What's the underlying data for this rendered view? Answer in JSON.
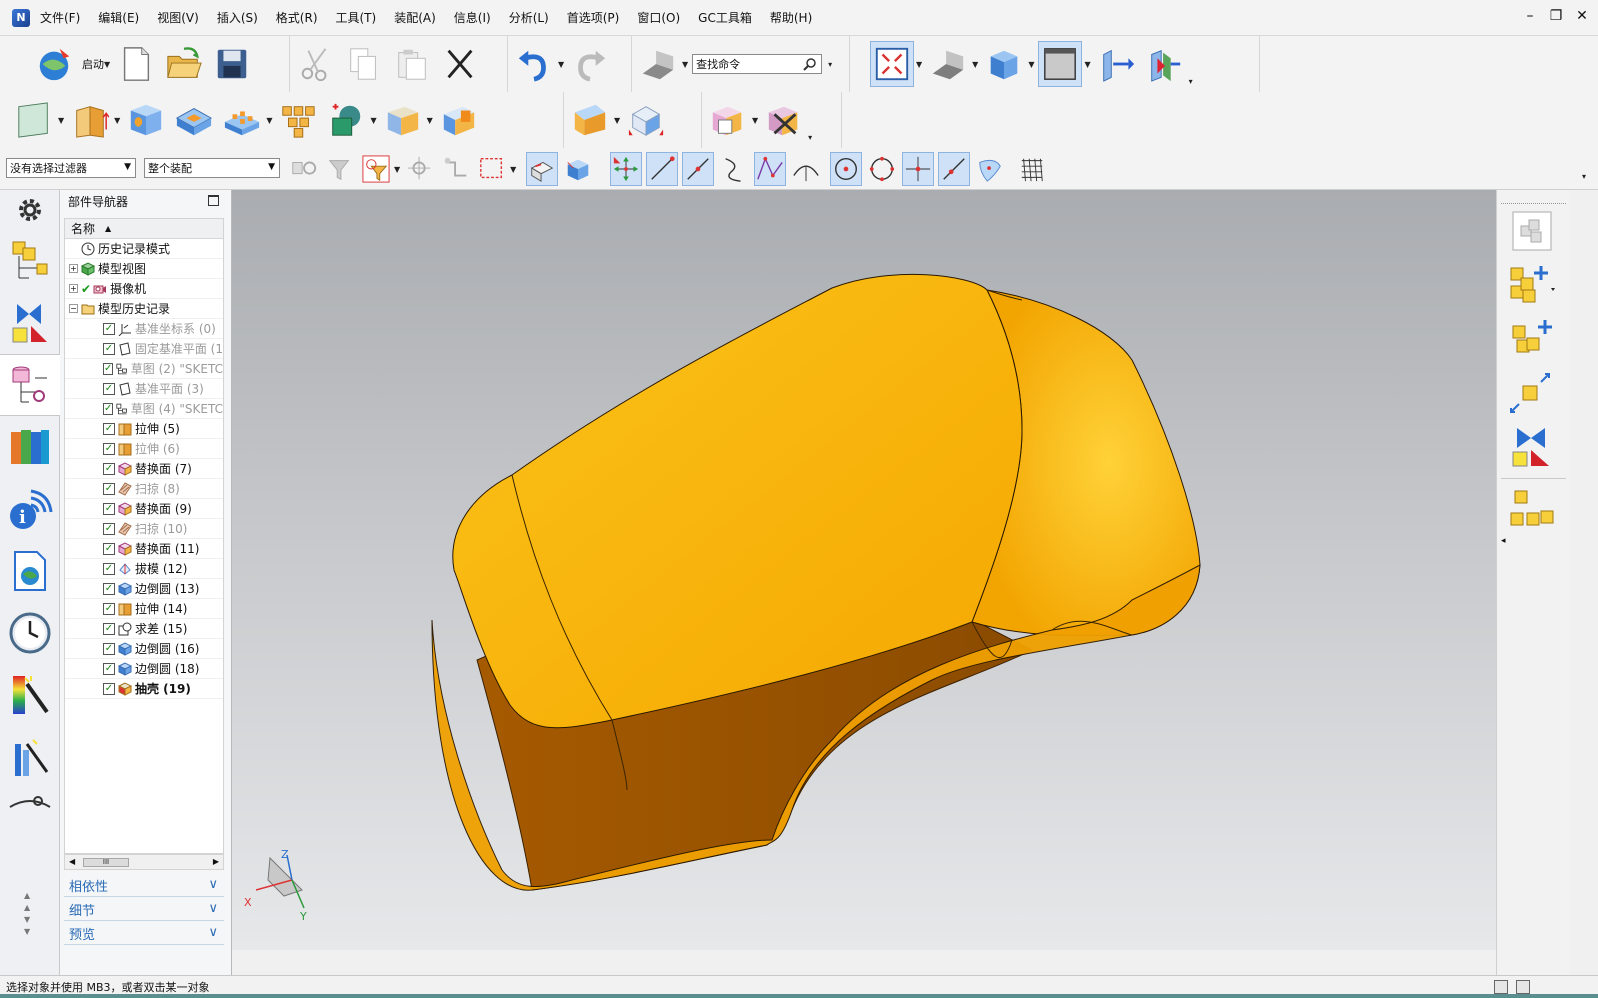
{
  "menu": {
    "items": [
      "文件(F)",
      "编辑(E)",
      "视图(V)",
      "插入(S)",
      "格式(R)",
      "工具(T)",
      "装配(A)",
      "信息(I)",
      "分析(L)",
      "首选项(P)",
      "窗口(O)",
      "GC工具箱",
      "帮助(H)"
    ]
  },
  "toolbar": {
    "launch_label": "启动",
    "search_placeholder": "查找命令"
  },
  "selection": {
    "filter_value": "没有选择过滤器",
    "scope_value": "整个装配"
  },
  "navigator": {
    "title": "部件导航器",
    "column_name": "名称",
    "nodes": [
      {
        "label": "历史记录模式"
      },
      {
        "label": "模型视图"
      },
      {
        "label": "摄像机"
      },
      {
        "label": "模型历史记录"
      },
      {
        "label": "基准坐标系 (0)"
      },
      {
        "label": "固定基准平面 (1"
      },
      {
        "label": "草图 (2) \"SKETC"
      },
      {
        "label": "基准平面 (3)"
      },
      {
        "label": "草图 (4) \"SKETC"
      },
      {
        "label": "拉伸 (5)"
      },
      {
        "label": "拉伸 (6)"
      },
      {
        "label": "替换面 (7)"
      },
      {
        "label": "扫掠 (8)"
      },
      {
        "label": "替换面 (9)"
      },
      {
        "label": "扫掠 (10)"
      },
      {
        "label": "替换面 (11)"
      },
      {
        "label": "拔模 (12)"
      },
      {
        "label": "边倒圆 (13)"
      },
      {
        "label": "拉伸 (14)"
      },
      {
        "label": "求差 (15)"
      },
      {
        "label": "边倒圆 (16)"
      },
      {
        "label": "边倒圆 (18)"
      },
      {
        "label": "抽壳 (19)"
      }
    ],
    "scroll_thumb": "III",
    "sections": [
      "相依性",
      "细节",
      "预览"
    ]
  },
  "triad": {
    "x": "X",
    "y": "Y",
    "z": "Z"
  },
  "status": {
    "message": "选择对象并使用 MB3，或者双击某一对象"
  },
  "colors": {
    "model_orange": "#f5a300",
    "accent_blue": "#2a6bb5",
    "viewport_top": "#a9acb0",
    "viewport_bottom": "#e7e8ea"
  }
}
